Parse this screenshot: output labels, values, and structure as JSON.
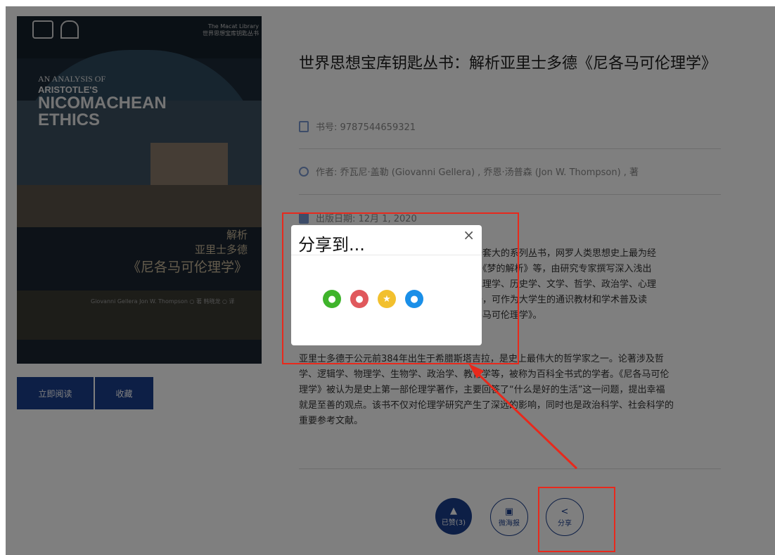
{
  "book": {
    "title": "世界思想宝库钥匙丛书：解析亚里士多德《尼各马可伦理学》",
    "isbn_label": "书号: 9787544659321",
    "author_label": "作者: 乔瓦尼·盖勒 (Giovanni Gellera) , 乔恩·汤普森 (Jon W. Thompson) , 著",
    "date_label": "出版日期: 12月 1, 2020",
    "desc1_tail": [
      "识翻译的一套大的系列丛书，网罗人类思想史上最为经",
      "《资本论》《梦的解析》等，由研究专家撰写深入浅出",
      "经济学、地理学、历史学、文学、哲学、政治学、心理",
      "文汉英双语，可作为大学生的通识教材和学术普及读",
      "德的《尼各马可伦理学》。"
    ],
    "desc2": [
      "亚里士多德于公元前384年出生于希腊斯塔吉拉，是史上最伟大的哲学家之一。论著涉及哲",
      "学、逻辑学、物理学、生物学、政治学、教育学等，被称为百科全书式的学者。《尼各马可伦",
      "理学》被认为是史上第一部伦理学著作，主要回答了“什么是好的生活”这一问题，提出幸福",
      "就是至善的观点。该书不仅对伦理学研究产生了深远的影响，同时也是政治科学、社会科学的",
      "重要参考文献。"
    ]
  },
  "cover": {
    "publisher": "The Macat Library",
    "publisher_cn": "世界思想宝库钥匙丛书",
    "en_line1": "AN ANALYSIS OF",
    "en_line2": "ARISTOTLE'S",
    "en_line3": "NICOMACHEAN",
    "en_line4": "ETHICS",
    "cn_line1": "解析",
    "cn_line2": "亚里士多德",
    "cn_line3": "《尼各马可伦理学》",
    "authors": "Giovanni Gellera  Jon W. Thompson ○ 著   韩晓龙 ○ 译"
  },
  "buttons": {
    "read": "立即阅读",
    "favorite": "收藏"
  },
  "actions": {
    "like": "已赞(3)",
    "poster": "微海报",
    "share": "分享"
  },
  "modal": {
    "title": "分享到...",
    "close": "×",
    "targets": [
      "wechat-icon",
      "weibo-icon",
      "qzone-icon",
      "qq-icon"
    ]
  },
  "colors": {
    "primary": "#1a3e8c",
    "annotation": "#e8291c",
    "wechat": "#3fb42b",
    "weibo": "#e0585c",
    "qzone": "#f2c02e",
    "qq": "#1a8fe8"
  }
}
